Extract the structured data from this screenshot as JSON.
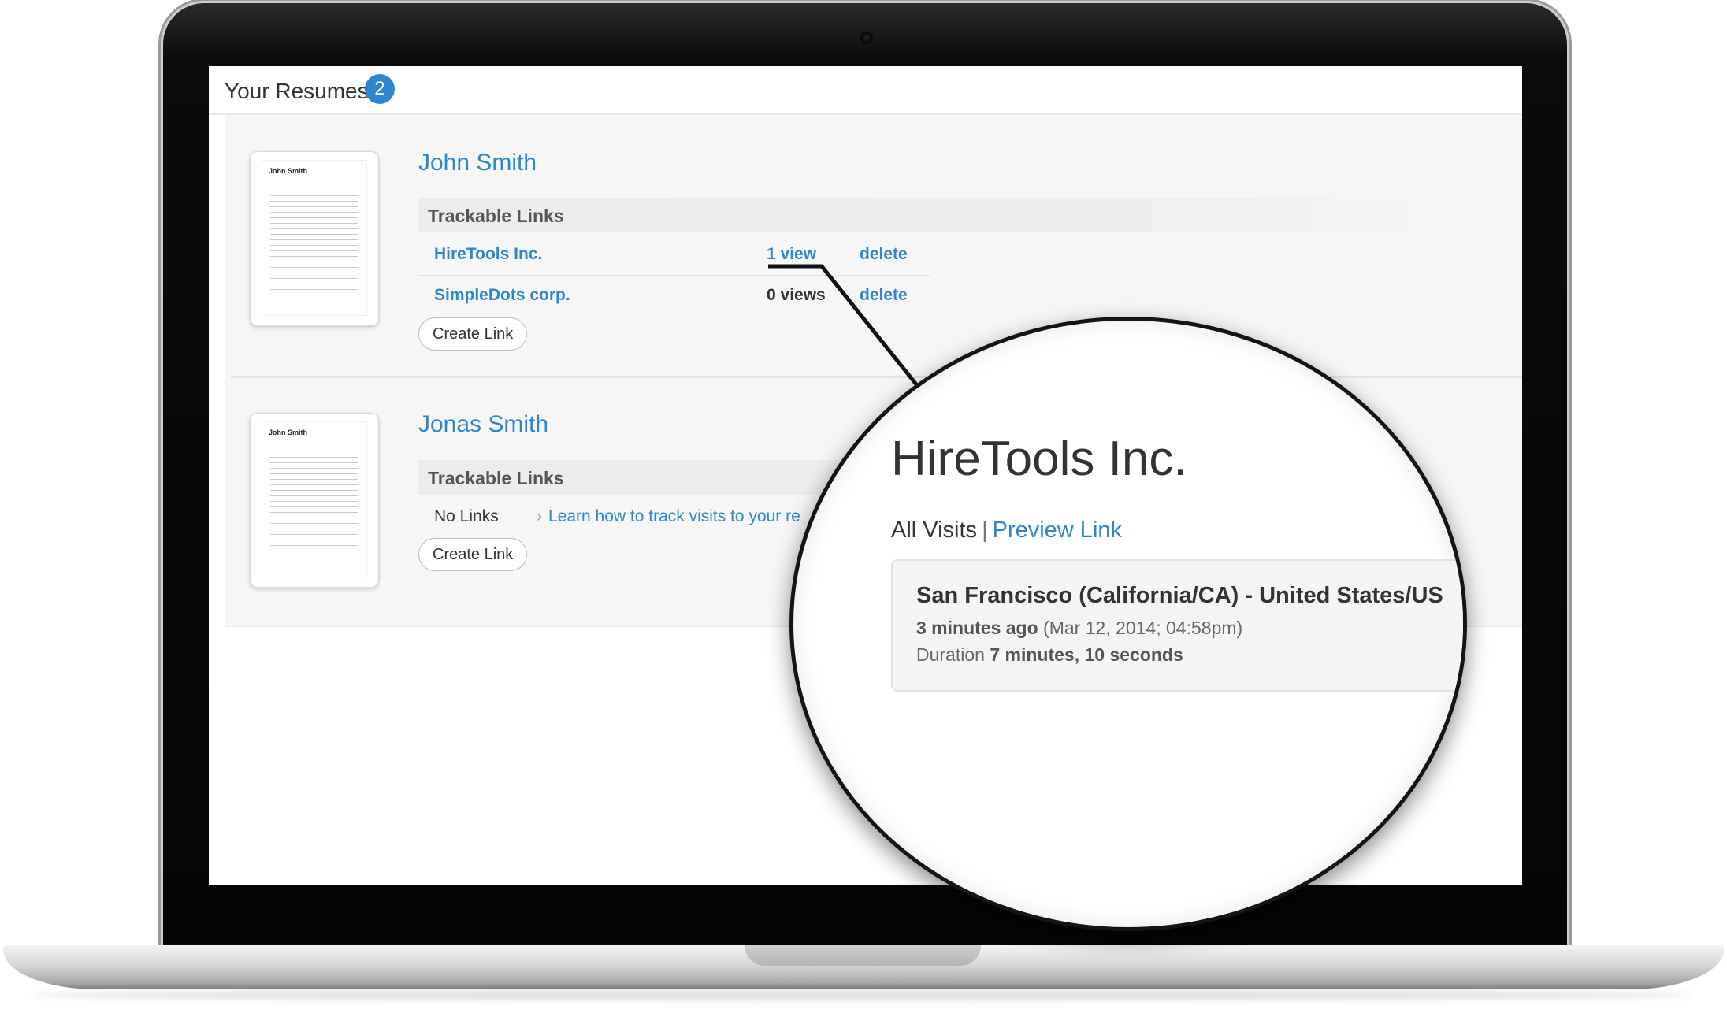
{
  "header": {
    "title": "Your Resumes",
    "count": "2"
  },
  "resumes": [
    {
      "name": "John Smith",
      "thumb_name": "John Smith",
      "section_label": "Trackable Links",
      "links": [
        {
          "name": "HireTools Inc.",
          "views": "1 view",
          "delete": "delete"
        },
        {
          "name": "SimpleDots corp.",
          "views": "0 views",
          "delete": "delete"
        }
      ],
      "create_label": "Create Link"
    },
    {
      "name": "Jonas Smith",
      "thumb_name": "John Smith",
      "section_label": "Trackable Links",
      "no_links": "No Links",
      "learn_link": "Learn how to track visits to your re",
      "create_label": "Create Link"
    }
  ],
  "zoom": {
    "title": "HireTools Inc.",
    "nav_all": "All Visits",
    "nav_sep": "|",
    "nav_preview": "Preview Link",
    "visit": {
      "location": "San Francisco (California/CA) - United States/US",
      "ago": "3 minutes ago",
      "timestamp": "(Mar 12, 2014; 04:58pm)",
      "duration_label": "Duration",
      "duration_value": "7 minutes, 10 seconds"
    }
  },
  "colors": {
    "accent": "#2f86d0",
    "text": "#333333",
    "panel": "#f6f6f6"
  }
}
